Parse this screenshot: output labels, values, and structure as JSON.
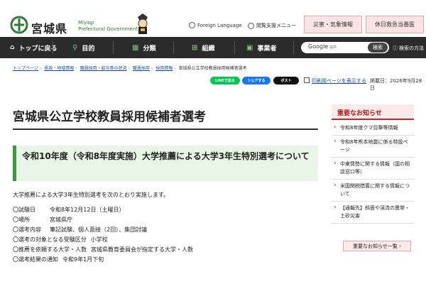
{
  "header": {
    "logo_text": "宮城県",
    "logo_en_line1": "Miyagi",
    "logo_en_line2": "Prefectural Government",
    "foreign_language": "Foreign Language",
    "accessibility_menu": "閲覧支援メニュー",
    "disaster_button": "災害・気象情報",
    "holiday_button": "休日救急当番医"
  },
  "nav": {
    "back_top": "トップに戻る",
    "purpose": "目的",
    "category": "分類",
    "organization": "組織",
    "business": "事業者",
    "search_placeholder": "Google",
    "search_sub": "提供",
    "search_button": "検索",
    "how_to_search": "検索の方法"
  },
  "breadcrumb": [
    "トップページ",
    "県政・地域情報",
    "職員採用・給与等の状況",
    "職員採用",
    "採用情報",
    "宮城県公立学校教員採用候補者選考"
  ],
  "share": {
    "line": "LINEで送る",
    "facebook": "シェアする",
    "x_post": "ポスト",
    "print": "印刷用ページを表示する",
    "published": "掲載日：2026年9月28日"
  },
  "main": {
    "title": "宮城県公立学校教員採用候補者選考",
    "subtitle": "令和10年度（令和8年度実施）大学推薦による大学3年生特別選考について",
    "intro": "大学推薦による大学3年生特別選考を次のとおり実施します。",
    "items": [
      {
        "label": "〇試験日",
        "value": "令和8年12月12日（土曜日）"
      },
      {
        "label": "〇場所",
        "value": "宮城県庁"
      },
      {
        "label": "〇選考内容",
        "value": "筆記試験、個人面接（2回）、集団討議"
      },
      {
        "label": "〇選考の対象となる受験区分",
        "value": "小学校"
      },
      {
        "label": "〇推薦を依頼する大学・人数",
        "value": "宮城県教育委員会が指定する大学・人数"
      },
      {
        "label": "〇選考結果の通知",
        "value": "令和9年1月下旬"
      }
    ]
  },
  "sidebar": {
    "heading": "重要なお知らせ",
    "items": [
      "令和8年度クマ目撃等情報",
      "令和8年熊本地震に係る特設ページ",
      "中東情勢に関する情報（国の相談窓口等）",
      "米国関税措置に関する情報について",
      "【通報先】斜面や渓流の異常・土砂災害"
    ],
    "more_button": "重要なお知らせ一覧 ›"
  },
  "colors": {
    "nav_bg": "#2b2b2b",
    "accent_green": "#3a9a3f",
    "accent_red": "#c62828",
    "line_green": "#06c755",
    "facebook_blue": "#1877f2"
  }
}
